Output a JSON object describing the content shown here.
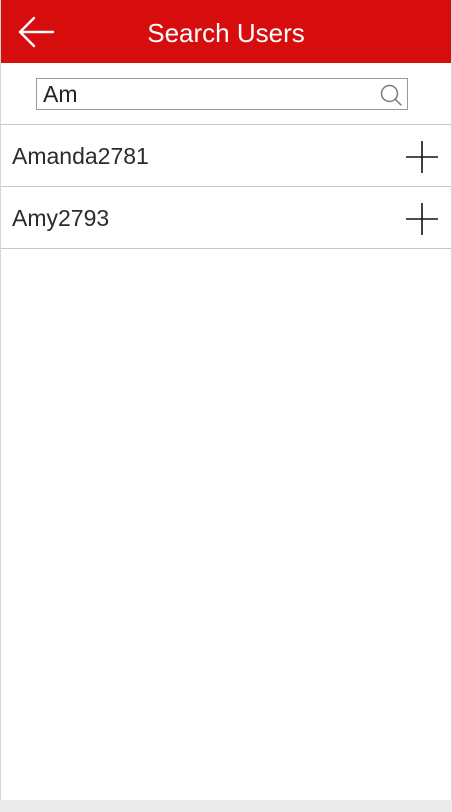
{
  "header": {
    "title": "Search Users",
    "background_color": "#d70c0c",
    "back_icon": "arrow-left-icon"
  },
  "search": {
    "value": "Am",
    "placeholder": "",
    "icon": "search-icon"
  },
  "results": [
    {
      "username": "Amanda2781",
      "action_icon": "plus-icon"
    },
    {
      "username": "Amy2793",
      "action_icon": "plus-icon"
    }
  ]
}
